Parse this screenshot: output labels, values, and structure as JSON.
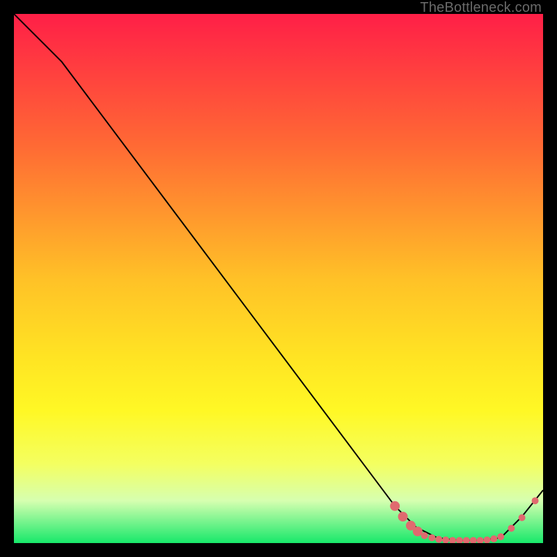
{
  "watermark": "TheBottleneck.com",
  "chart_data": {
    "type": "line",
    "title": "",
    "xlabel": "",
    "ylabel": "",
    "xlim": [
      0,
      100
    ],
    "ylim": [
      0,
      100
    ],
    "grid": false,
    "legend": false,
    "background_gradient": {
      "top_color": "#ff1f47",
      "mid_colors": [
        "#ff6a34",
        "#ffc127",
        "#ffe423",
        "#fff825",
        "#f4ff60",
        "#d6ffb0"
      ],
      "bottom_color": "#17e86a",
      "stops_pct": [
        0,
        25,
        50,
        65,
        75,
        85,
        92,
        100
      ]
    },
    "series": [
      {
        "name": "curve",
        "color": "#000000",
        "stroke_width": 2,
        "x": [
          0,
          3,
          6,
          9,
          72,
          76,
          80,
          84,
          88,
          92,
          96,
          100
        ],
        "y": [
          100,
          97,
          94,
          91,
          7,
          3,
          1,
          0.5,
          0.5,
          1,
          5,
          10
        ]
      }
    ],
    "markers": {
      "name": "dots",
      "color": "#e06a6f",
      "radius_small": 5,
      "radius_large": 7,
      "points": [
        {
          "x": 72.0,
          "y": 7.0,
          "r": "l"
        },
        {
          "x": 73.5,
          "y": 5.0,
          "r": "l"
        },
        {
          "x": 75.0,
          "y": 3.3,
          "r": "l"
        },
        {
          "x": 76.3,
          "y": 2.2,
          "r": "l"
        },
        {
          "x": 77.6,
          "y": 1.4,
          "r": "s"
        },
        {
          "x": 79.0,
          "y": 1.0,
          "r": "s"
        },
        {
          "x": 80.3,
          "y": 0.7,
          "r": "s"
        },
        {
          "x": 81.6,
          "y": 0.6,
          "r": "s"
        },
        {
          "x": 82.9,
          "y": 0.5,
          "r": "s"
        },
        {
          "x": 84.2,
          "y": 0.5,
          "r": "s"
        },
        {
          "x": 85.5,
          "y": 0.5,
          "r": "s"
        },
        {
          "x": 86.8,
          "y": 0.5,
          "r": "s"
        },
        {
          "x": 88.1,
          "y": 0.5,
          "r": "s"
        },
        {
          "x": 89.4,
          "y": 0.6,
          "r": "s"
        },
        {
          "x": 90.7,
          "y": 0.8,
          "r": "s"
        },
        {
          "x": 92.0,
          "y": 1.2,
          "r": "s"
        },
        {
          "x": 94.0,
          "y": 2.8,
          "r": "s"
        },
        {
          "x": 96.0,
          "y": 4.8,
          "r": "s"
        },
        {
          "x": 98.5,
          "y": 8.0,
          "r": "s"
        }
      ]
    }
  }
}
